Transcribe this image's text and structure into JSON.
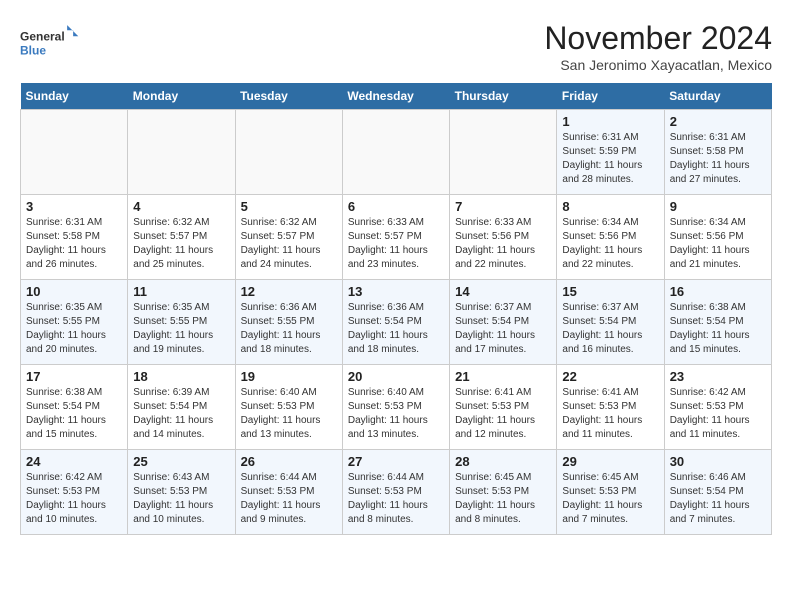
{
  "logo": {
    "line1": "General",
    "line2": "Blue"
  },
  "title": "November 2024",
  "location": "San Jeronimo Xayacatlan, Mexico",
  "weekdays": [
    "Sunday",
    "Monday",
    "Tuesday",
    "Wednesday",
    "Thursday",
    "Friday",
    "Saturday"
  ],
  "weeks": [
    [
      {
        "day": "",
        "info": ""
      },
      {
        "day": "",
        "info": ""
      },
      {
        "day": "",
        "info": ""
      },
      {
        "day": "",
        "info": ""
      },
      {
        "day": "",
        "info": ""
      },
      {
        "day": "1",
        "info": "Sunrise: 6:31 AM\nSunset: 5:59 PM\nDaylight: 11 hours and 28 minutes."
      },
      {
        "day": "2",
        "info": "Sunrise: 6:31 AM\nSunset: 5:58 PM\nDaylight: 11 hours and 27 minutes."
      }
    ],
    [
      {
        "day": "3",
        "info": "Sunrise: 6:31 AM\nSunset: 5:58 PM\nDaylight: 11 hours and 26 minutes."
      },
      {
        "day": "4",
        "info": "Sunrise: 6:32 AM\nSunset: 5:57 PM\nDaylight: 11 hours and 25 minutes."
      },
      {
        "day": "5",
        "info": "Sunrise: 6:32 AM\nSunset: 5:57 PM\nDaylight: 11 hours and 24 minutes."
      },
      {
        "day": "6",
        "info": "Sunrise: 6:33 AM\nSunset: 5:57 PM\nDaylight: 11 hours and 23 minutes."
      },
      {
        "day": "7",
        "info": "Sunrise: 6:33 AM\nSunset: 5:56 PM\nDaylight: 11 hours and 22 minutes."
      },
      {
        "day": "8",
        "info": "Sunrise: 6:34 AM\nSunset: 5:56 PM\nDaylight: 11 hours and 22 minutes."
      },
      {
        "day": "9",
        "info": "Sunrise: 6:34 AM\nSunset: 5:56 PM\nDaylight: 11 hours and 21 minutes."
      }
    ],
    [
      {
        "day": "10",
        "info": "Sunrise: 6:35 AM\nSunset: 5:55 PM\nDaylight: 11 hours and 20 minutes."
      },
      {
        "day": "11",
        "info": "Sunrise: 6:35 AM\nSunset: 5:55 PM\nDaylight: 11 hours and 19 minutes."
      },
      {
        "day": "12",
        "info": "Sunrise: 6:36 AM\nSunset: 5:55 PM\nDaylight: 11 hours and 18 minutes."
      },
      {
        "day": "13",
        "info": "Sunrise: 6:36 AM\nSunset: 5:54 PM\nDaylight: 11 hours and 18 minutes."
      },
      {
        "day": "14",
        "info": "Sunrise: 6:37 AM\nSunset: 5:54 PM\nDaylight: 11 hours and 17 minutes."
      },
      {
        "day": "15",
        "info": "Sunrise: 6:37 AM\nSunset: 5:54 PM\nDaylight: 11 hours and 16 minutes."
      },
      {
        "day": "16",
        "info": "Sunrise: 6:38 AM\nSunset: 5:54 PM\nDaylight: 11 hours and 15 minutes."
      }
    ],
    [
      {
        "day": "17",
        "info": "Sunrise: 6:38 AM\nSunset: 5:54 PM\nDaylight: 11 hours and 15 minutes."
      },
      {
        "day": "18",
        "info": "Sunrise: 6:39 AM\nSunset: 5:54 PM\nDaylight: 11 hours and 14 minutes."
      },
      {
        "day": "19",
        "info": "Sunrise: 6:40 AM\nSunset: 5:53 PM\nDaylight: 11 hours and 13 minutes."
      },
      {
        "day": "20",
        "info": "Sunrise: 6:40 AM\nSunset: 5:53 PM\nDaylight: 11 hours and 13 minutes."
      },
      {
        "day": "21",
        "info": "Sunrise: 6:41 AM\nSunset: 5:53 PM\nDaylight: 11 hours and 12 minutes."
      },
      {
        "day": "22",
        "info": "Sunrise: 6:41 AM\nSunset: 5:53 PM\nDaylight: 11 hours and 11 minutes."
      },
      {
        "day": "23",
        "info": "Sunrise: 6:42 AM\nSunset: 5:53 PM\nDaylight: 11 hours and 11 minutes."
      }
    ],
    [
      {
        "day": "24",
        "info": "Sunrise: 6:42 AM\nSunset: 5:53 PM\nDaylight: 11 hours and 10 minutes."
      },
      {
        "day": "25",
        "info": "Sunrise: 6:43 AM\nSunset: 5:53 PM\nDaylight: 11 hours and 10 minutes."
      },
      {
        "day": "26",
        "info": "Sunrise: 6:44 AM\nSunset: 5:53 PM\nDaylight: 11 hours and 9 minutes."
      },
      {
        "day": "27",
        "info": "Sunrise: 6:44 AM\nSunset: 5:53 PM\nDaylight: 11 hours and 8 minutes."
      },
      {
        "day": "28",
        "info": "Sunrise: 6:45 AM\nSunset: 5:53 PM\nDaylight: 11 hours and 8 minutes."
      },
      {
        "day": "29",
        "info": "Sunrise: 6:45 AM\nSunset: 5:53 PM\nDaylight: 11 hours and 7 minutes."
      },
      {
        "day": "30",
        "info": "Sunrise: 6:46 AM\nSunset: 5:54 PM\nDaylight: 11 hours and 7 minutes."
      }
    ]
  ]
}
